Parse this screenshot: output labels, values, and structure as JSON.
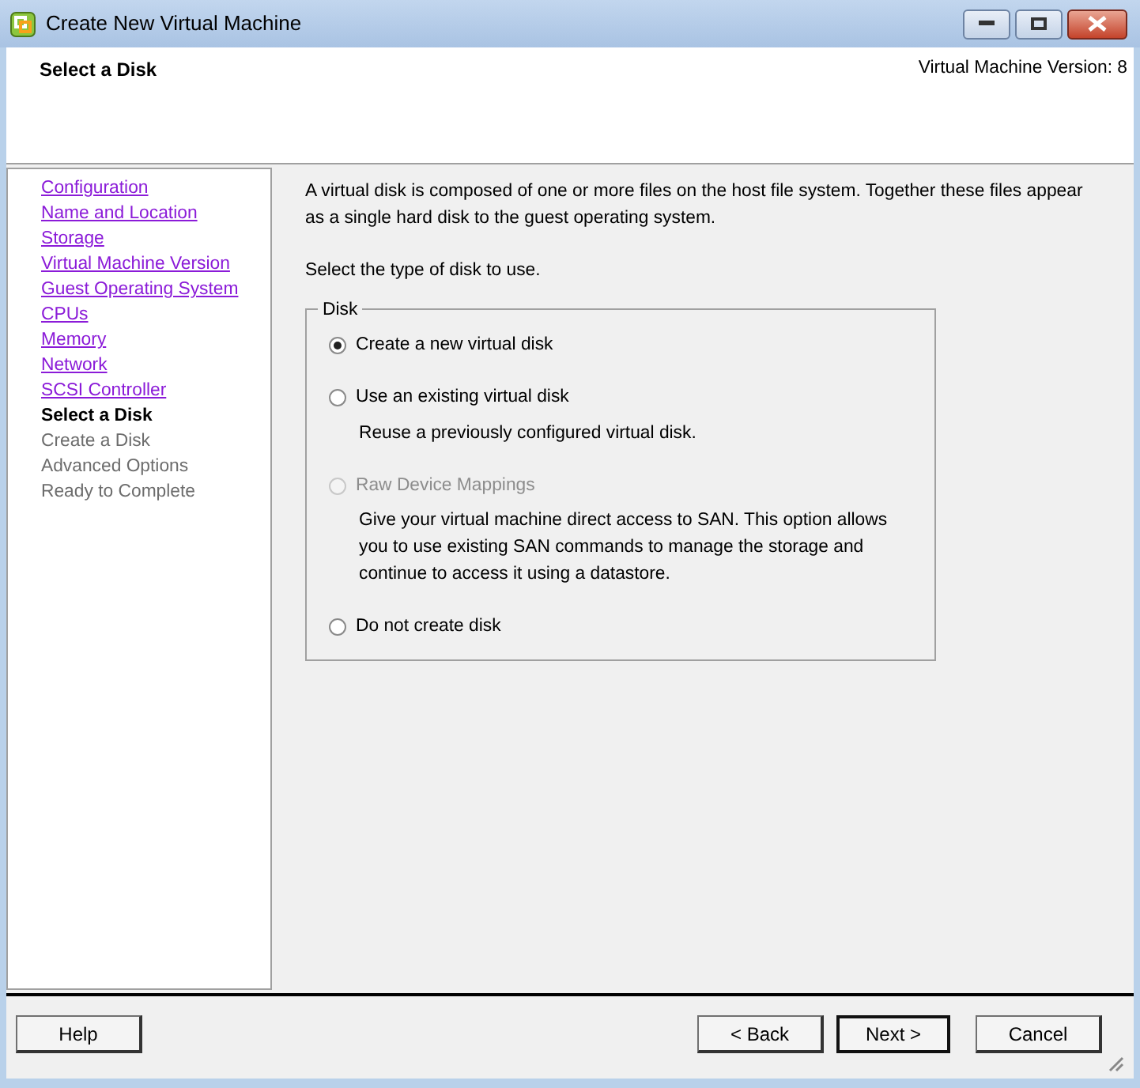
{
  "window": {
    "title": "Create New Virtual Machine"
  },
  "header": {
    "title": "Select a Disk",
    "version": "Virtual Machine Version: 8"
  },
  "steps": [
    {
      "label": "Configuration",
      "kind": "link"
    },
    {
      "label": "Name and Location",
      "kind": "link"
    },
    {
      "label": "Storage",
      "kind": "link"
    },
    {
      "label": "Virtual Machine Version",
      "kind": "link"
    },
    {
      "label": "Guest Operating System",
      "kind": "link"
    },
    {
      "label": "CPUs",
      "kind": "link"
    },
    {
      "label": "Memory",
      "kind": "link"
    },
    {
      "label": "Network",
      "kind": "link"
    },
    {
      "label": "SCSI Controller",
      "kind": "link"
    },
    {
      "label": "Select a Disk",
      "kind": "current"
    },
    {
      "label": "Create a Disk",
      "kind": "pending"
    },
    {
      "label": "Advanced Options",
      "kind": "pending"
    },
    {
      "label": "Ready to Complete",
      "kind": "pending"
    }
  ],
  "intro": "A virtual disk is composed of one or more files on the host file system. Together these files appear as a single hard disk to the guest operating system.",
  "prompt": "Select the type of disk to use.",
  "disk_group": {
    "legend": "Disk",
    "options": [
      {
        "label": "Create a new virtual disk",
        "selected": true,
        "disabled": false
      },
      {
        "label": "Use an existing virtual disk",
        "selected": false,
        "disabled": false,
        "description": "Reuse a previously configured virtual disk."
      },
      {
        "label": "Raw Device Mappings",
        "selected": false,
        "disabled": true,
        "description": "Give your virtual machine direct access to SAN. This option allows you to use existing SAN commands to manage the storage and continue to access it using a datastore."
      },
      {
        "label": "Do not create disk",
        "selected": false,
        "disabled": false
      }
    ]
  },
  "buttons": [
    {
      "label": "Help",
      "kind": "left"
    },
    {
      "label": "< Back",
      "kind": "right"
    },
    {
      "label": "Next >",
      "kind": "default"
    },
    {
      "label": "Cancel",
      "kind": "right"
    }
  ]
}
